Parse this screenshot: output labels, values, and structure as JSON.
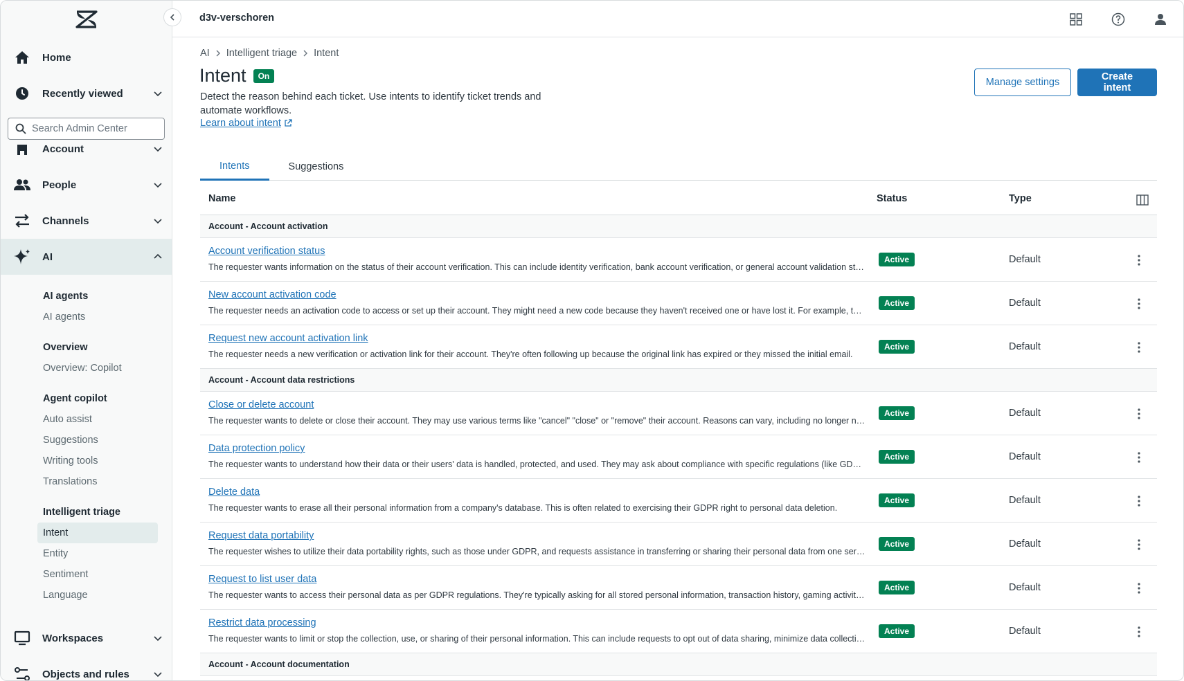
{
  "header": {
    "org_name": "d3v-verschoren",
    "icons": [
      "products-grid-icon",
      "help-icon",
      "user-profile-icon"
    ]
  },
  "sidebar": {
    "home": "Home",
    "recently_viewed": "Recently viewed",
    "search_placeholder": "Search Admin Center",
    "account": "Account",
    "people": "People",
    "channels": "Channels",
    "ai": "AI",
    "workspaces": "Workspaces",
    "objects_and_rules": "Objects and rules",
    "sections": [
      {
        "heading": "AI agents",
        "links": [
          "AI agents"
        ]
      },
      {
        "heading": "Overview",
        "links": [
          "Overview: Copilot"
        ]
      },
      {
        "heading": "Agent copilot",
        "links": [
          "Auto assist",
          "Suggestions",
          "Writing tools",
          "Translations"
        ]
      },
      {
        "heading": "Intelligent triage",
        "links": [
          "Intent",
          "Entity",
          "Sentiment",
          "Language"
        ]
      }
    ]
  },
  "page": {
    "breadcrumb": [
      "AI",
      "Intelligent triage",
      "Intent"
    ],
    "title": "Intent",
    "status_badge": "On",
    "description": "Detect the reason behind each ticket. Use intents to identify ticket trends and automate workflows.",
    "learn_link": "Learn about intent",
    "manage_settings": "Manage settings",
    "create_intent": "Create intent",
    "tabs": [
      "Intents",
      "Suggestions"
    ]
  },
  "table": {
    "columns": {
      "name": "Name",
      "status": "Status",
      "type": "Type"
    },
    "groups": [
      {
        "label": "Account - Account activation",
        "rows": [
          {
            "name": "Account verification status",
            "desc": "The requester wants information on the status of their account verification. This can include identity verification, bank account verification, or general account validation status.",
            "status": "Active",
            "type": "Default"
          },
          {
            "name": "New account activation code",
            "desc": "The requester needs an activation code to access or set up their account. They might need a new code because they haven't received one or have lost it. For example, their code has expired.",
            "status": "Active",
            "type": "Default"
          },
          {
            "name": "Request new account activation link",
            "desc": "The requester needs a new verification or activation link for their account. They're often following up because the original link has expired or they missed the initial email.",
            "status": "Active",
            "type": "Default"
          }
        ]
      },
      {
        "label": "Account - Account data restrictions",
        "rows": [
          {
            "name": "Close or delete account",
            "desc": "The requester wants to delete or close their account. They may use various terms like \"cancel\" \"close\" or \"remove\" their account. Reasons can vary, including no longer needing the service.",
            "status": "Active",
            "type": "Default"
          },
          {
            "name": "Data protection policy",
            "desc": "The requester wants to understand how their data or their users' data is handled, protected, and used. They may ask about compliance with specific regulations (like GDPR).",
            "status": "Active",
            "type": "Default"
          },
          {
            "name": "Delete data",
            "desc": "The requester wants to erase all their personal information from a company's database. This is often related to exercising their GDPR right to personal data deletion.",
            "status": "Active",
            "type": "Default"
          },
          {
            "name": "Request data portability",
            "desc": "The requester wishes to utilize their data portability rights, such as those under GDPR, and requests assistance in transferring or sharing their personal data from one service to another.",
            "status": "Active",
            "type": "Default"
          },
          {
            "name": "Request to list user data",
            "desc": "The requester wants to access their personal data as per GDPR regulations. They're typically asking for all stored personal information, transaction history, gaming activity and more.",
            "status": "Active",
            "type": "Default"
          },
          {
            "name": "Restrict data processing",
            "desc": "The requester wants to limit or stop the collection, use, or sharing of their personal information. This can include requests to opt out of data sharing, minimize data collection.",
            "status": "Active",
            "type": "Default"
          }
        ]
      },
      {
        "label": "Account - Account documentation",
        "rows": []
      }
    ]
  }
}
